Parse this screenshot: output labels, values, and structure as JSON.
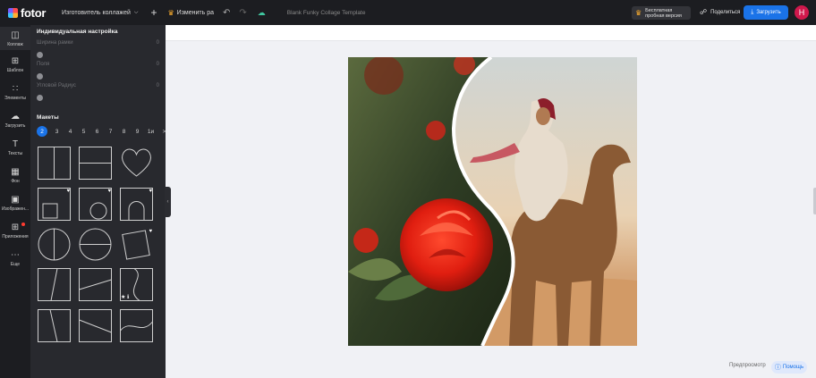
{
  "app": {
    "name": "fotor"
  },
  "topbar": {
    "maker_label": "Изготовитель коллажей",
    "resize_label": "Изменить ра",
    "doc_title": "Blank Funky Collage Template",
    "trial_line1": "Бесплатная",
    "trial_line2": "пробная версия",
    "share_label": "Поделиться",
    "download_label": "Загрузить",
    "avatar_letter": "H"
  },
  "rail": {
    "items": [
      {
        "label": "Коллаж",
        "icon": "collage-icon"
      },
      {
        "label": "Шаблон",
        "icon": "template-icon"
      },
      {
        "label": "Элементы",
        "icon": "elements-icon"
      },
      {
        "label": "Загрузить",
        "icon": "upload-icon"
      },
      {
        "label": "Тексты",
        "icon": "text-icon"
      },
      {
        "label": "Фон",
        "icon": "background-icon"
      },
      {
        "label": "Изображен...",
        "icon": "image-icon"
      },
      {
        "label": "Приложения",
        "icon": "apps-icon"
      },
      {
        "label": "Еще",
        "icon": "more-icon"
      }
    ]
  },
  "panel": {
    "settings_title": "Индивидуальная настройка",
    "sliders": [
      {
        "label": "Ширина рамки",
        "value": "0"
      },
      {
        "label": "Поля",
        "value": "0"
      },
      {
        "label": "Угловой Радиус",
        "value": "0"
      }
    ],
    "layouts_title": "Макеты",
    "pages": [
      "2",
      "3",
      "4",
      "5",
      "6",
      "7",
      "8",
      "9",
      "1и",
      ">"
    ]
  },
  "canvas": {
    "preview_label": "Предпросмотр",
    "help_label": "Помощь"
  },
  "colors": {
    "accent": "#1a73e8",
    "topbar": "#1c1d21",
    "panel": "#28292e",
    "avatar": "#d0184c"
  }
}
